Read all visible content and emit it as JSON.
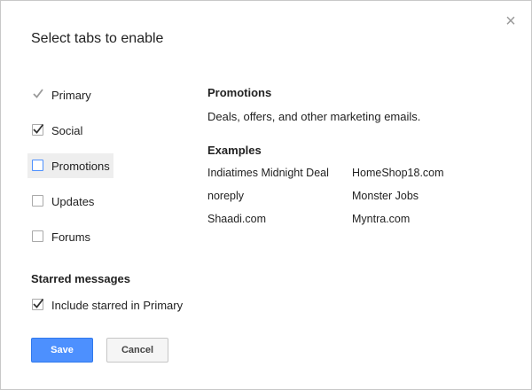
{
  "dialog": {
    "title": "Select tabs to enable",
    "close_glyph": "×"
  },
  "tabs": [
    {
      "label": "Primary",
      "state": "locked-checked"
    },
    {
      "label": "Social",
      "state": "checked"
    },
    {
      "label": "Promotions",
      "state": "unchecked-focused"
    },
    {
      "label": "Updates",
      "state": "unchecked"
    },
    {
      "label": "Forums",
      "state": "unchecked"
    }
  ],
  "starred": {
    "heading": "Starred messages",
    "option_label": "Include starred in Primary",
    "checked": true
  },
  "details": {
    "heading": "Promotions",
    "description": "Deals, offers, and other marketing emails.",
    "examples_heading": "Examples",
    "examples": [
      [
        "Indiatimes Midnight Deal",
        "HomeShop18.com"
      ],
      [
        "noreply",
        "Monster Jobs"
      ],
      [
        "Shaadi.com",
        "Myntra.com"
      ]
    ]
  },
  "buttons": {
    "save": "Save",
    "cancel": "Cancel"
  },
  "colors": {
    "primary_button": "#4d90fe",
    "focused_row_bg": "#eeeeee"
  }
}
